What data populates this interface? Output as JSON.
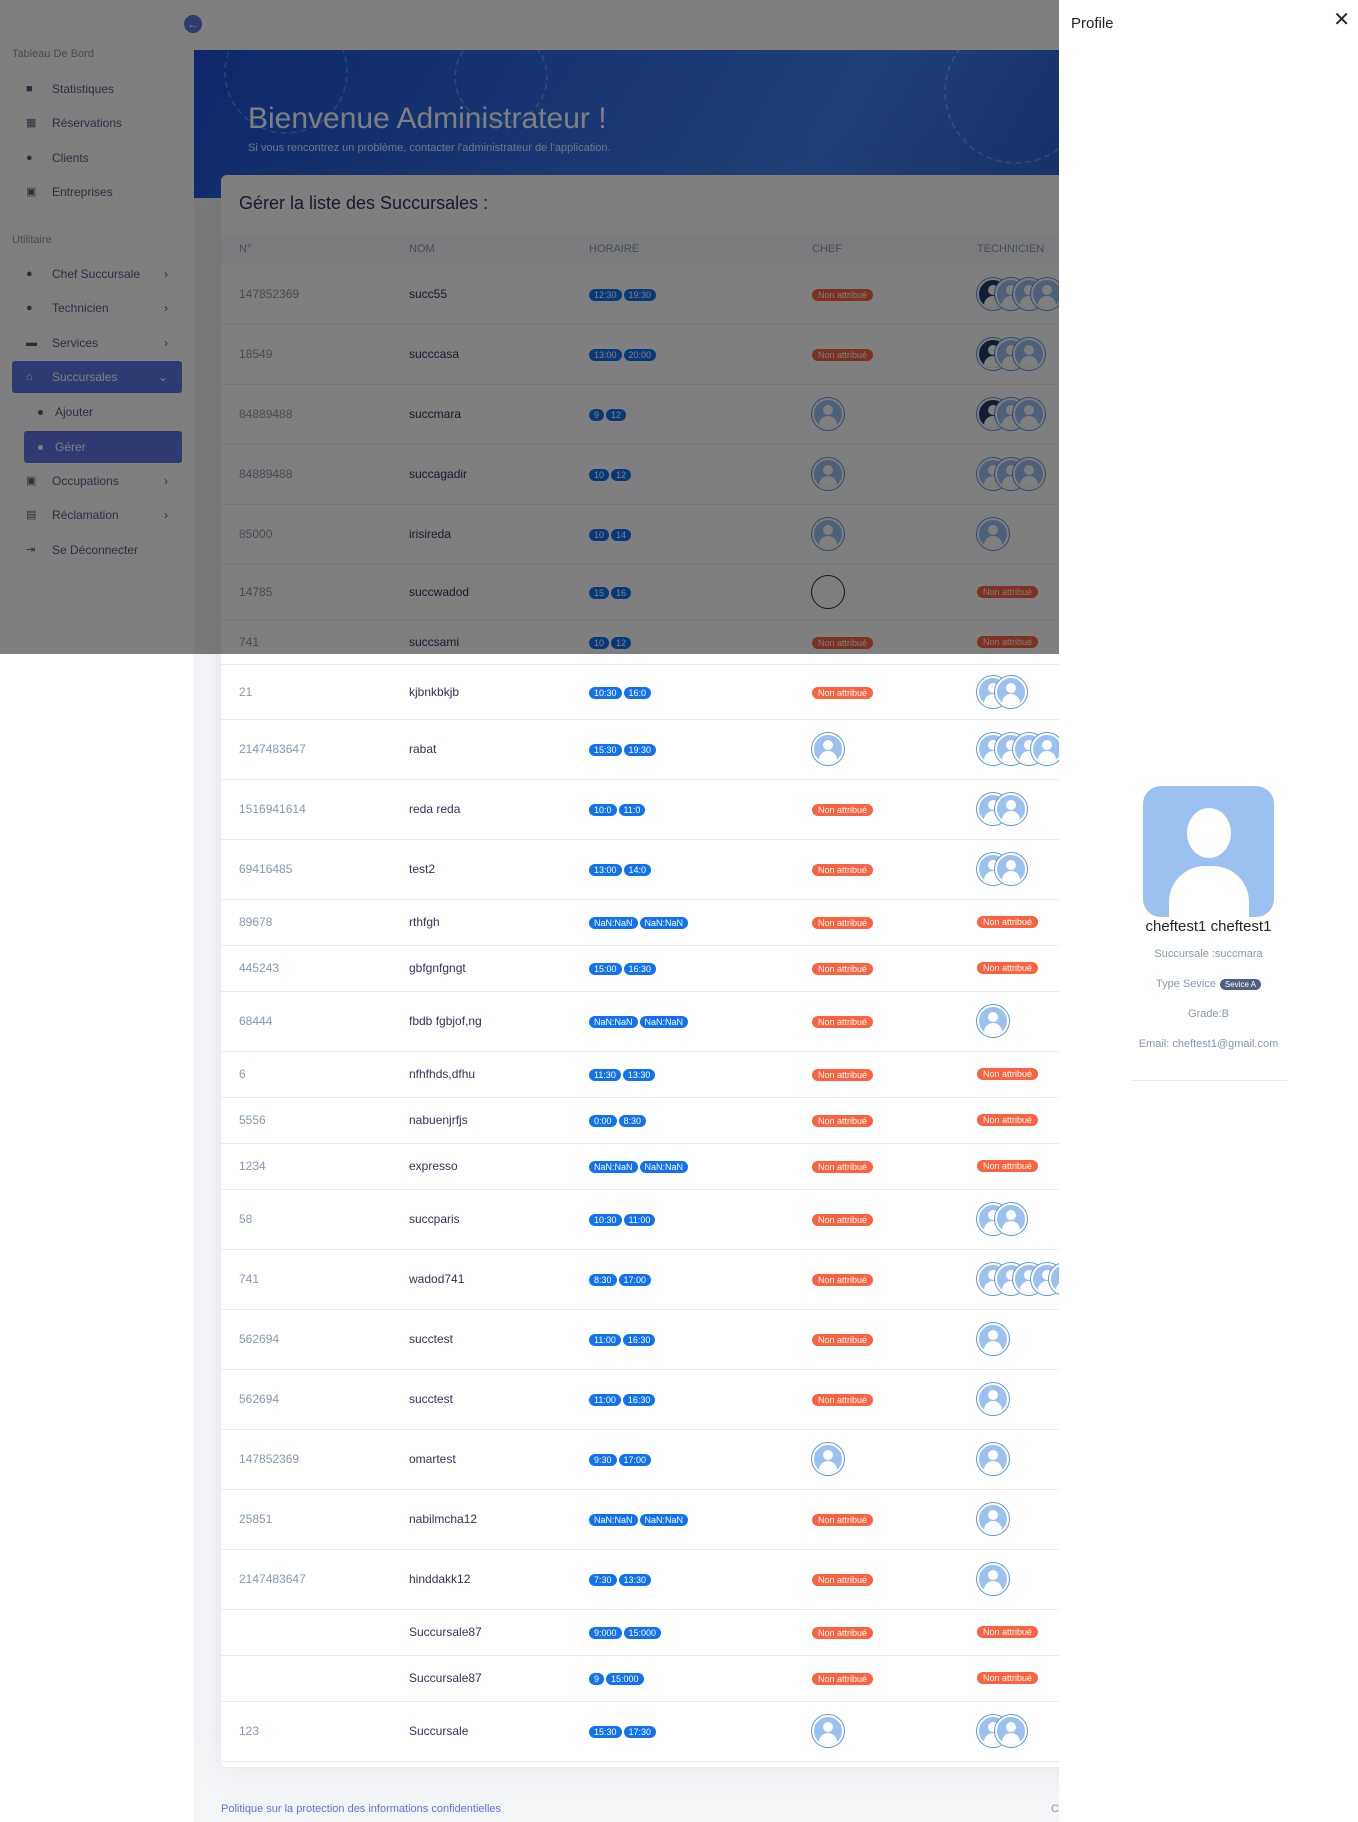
{
  "sidebar": {
    "section_dashboard": "Tableau De Bord",
    "section_utility": "Utilitaire",
    "items": [
      {
        "label": "Statistiques"
      },
      {
        "label": "Réservations"
      },
      {
        "label": "Clients"
      },
      {
        "label": "Entreprises"
      },
      {
        "label": "Chef Succursale"
      },
      {
        "label": "Technicien"
      },
      {
        "label": "Services"
      },
      {
        "label": "Succursales"
      },
      {
        "label": "Occupations"
      },
      {
        "label": "Réclamation"
      },
      {
        "label": "Se Déconnecter"
      }
    ],
    "sub_items": [
      {
        "label": "Ajouter"
      },
      {
        "label": "Gérer"
      }
    ]
  },
  "banner": {
    "title": "Bienvenue Administrateur !",
    "subtitle": "Si vous rencontrez un problème, contacter l'administrateur de l'application."
  },
  "card": {
    "title": "Gérer la liste des Succursales :",
    "headers": [
      "N°",
      "NOM",
      "HORAIRE",
      "CHEF",
      "TECHNICIEN"
    ]
  },
  "non_attribue": "Non attribué",
  "rows": [
    {
      "num": "147852369",
      "nom": "succ55",
      "h1": "12:30",
      "h2": "19:30",
      "chef": "na",
      "tech": "4"
    },
    {
      "num": "18549",
      "nom": "succcasa",
      "h1": "13:00",
      "h2": "20:00",
      "chef": "na",
      "tech": "3"
    },
    {
      "num": "84889488",
      "nom": "succmara",
      "h1": "9",
      "h2": "12",
      "chef": "av",
      "tech": "3"
    },
    {
      "num": "84889488",
      "nom": "succagadir",
      "h1": "10",
      "h2": "12",
      "chef": "av",
      "tech": "3"
    },
    {
      "num": "85000",
      "nom": "irisireda",
      "h1": "10",
      "h2": "14",
      "chef": "av",
      "tech": "1"
    },
    {
      "num": "14785",
      "nom": "succwadod",
      "h1": "15",
      "h2": "16",
      "chef": "empty",
      "tech": "na"
    },
    {
      "num": "741",
      "nom": "succsami",
      "h1": "10",
      "h2": "12",
      "chef": "na",
      "tech": "na"
    },
    {
      "num": "21",
      "nom": "kjbnkbkjb",
      "h1": "10:30",
      "h2": "16:0",
      "chef": "na",
      "tech": "2"
    },
    {
      "num": "2147483647",
      "nom": "rabat",
      "h1": "15:30",
      "h2": "19:30",
      "chef": "av",
      "tech": "4"
    },
    {
      "num": "1516941614",
      "nom": "reda reda",
      "h1": "10:0",
      "h2": "11:0",
      "chef": "na",
      "tech": "2"
    },
    {
      "num": "69416485",
      "nom": "test2",
      "h1": "13:00",
      "h2": "14:0",
      "chef": "na",
      "tech": "2"
    },
    {
      "num": "89678",
      "nom": "rthfgh",
      "h1": "NaN:NaN",
      "h2": "NaN:NaN",
      "chef": "na",
      "tech": "na"
    },
    {
      "num": "445243",
      "nom": "gbfgnfgngt",
      "h1": "15:00",
      "h2": "16:30",
      "chef": "na",
      "tech": "na"
    },
    {
      "num": "68444",
      "nom": "fbdb fgbjof,ng",
      "h1": "NaN:NaN",
      "h2": "NaN:NaN",
      "chef": "na",
      "tech": "1"
    },
    {
      "num": "6",
      "nom": "nfhfhds,dfhu",
      "h1": "11:30",
      "h2": "13:30",
      "chef": "na",
      "tech": "na"
    },
    {
      "num": "5556",
      "nom": "nabuenjrfjs",
      "h1": "0:00",
      "h2": "8:30",
      "chef": "na",
      "tech": "na"
    },
    {
      "num": "1234",
      "nom": "expresso",
      "h1": "NaN:NaN",
      "h2": "NaN:NaN",
      "chef": "na",
      "tech": "na"
    },
    {
      "num": "58",
      "nom": "succparis",
      "h1": "10:30",
      "h2": "11:00",
      "chef": "na",
      "tech": "2"
    },
    {
      "num": "741",
      "nom": "wadod741",
      "h1": "8:30",
      "h2": "17:00",
      "chef": "na",
      "tech": "5"
    },
    {
      "num": "562694",
      "nom": "succtest",
      "h1": "11:00",
      "h2": "16:30",
      "chef": "na",
      "tech": "1"
    },
    {
      "num": "562694",
      "nom": "succtest",
      "h1": "11:00",
      "h2": "16:30",
      "chef": "na",
      "tech": "1"
    },
    {
      "num": "147852369",
      "nom": "omartest",
      "h1": "9:30",
      "h2": "17:00",
      "chef": "av",
      "tech": "1"
    },
    {
      "num": "25851",
      "nom": "nabilmcha12",
      "h1": "NaN:NaN",
      "h2": "NaN:NaN",
      "chef": "na",
      "tech": "1"
    },
    {
      "num": "2147483647",
      "nom": "hinddakk12",
      "h1": "7:30",
      "h2": "13:30",
      "chef": "na",
      "tech": "1"
    },
    {
      "num": "",
      "nom": "Succursale87",
      "h1": "9:000",
      "h2": "15:000",
      "chef": "na",
      "tech": "na"
    },
    {
      "num": "",
      "nom": "Succursale87",
      "h1": "9",
      "h2": "15:000",
      "chef": "na",
      "tech": "na"
    },
    {
      "num": "123",
      "nom": "Succursale",
      "h1": "15:30",
      "h2": "17:30",
      "chef": "av",
      "tech": "2"
    }
  ],
  "footer": {
    "link": "Politique sur la protection des informations confidentielles",
    "copy": "C"
  },
  "profile": {
    "title": "Profile",
    "name": "cheftest1 cheftest1",
    "succursale": "Succursale :succmara",
    "type_label": "Type Sevice",
    "type_badge": "Sevice A",
    "grade": "Grade:B",
    "email": "Email: cheftest1@gmail.com"
  }
}
